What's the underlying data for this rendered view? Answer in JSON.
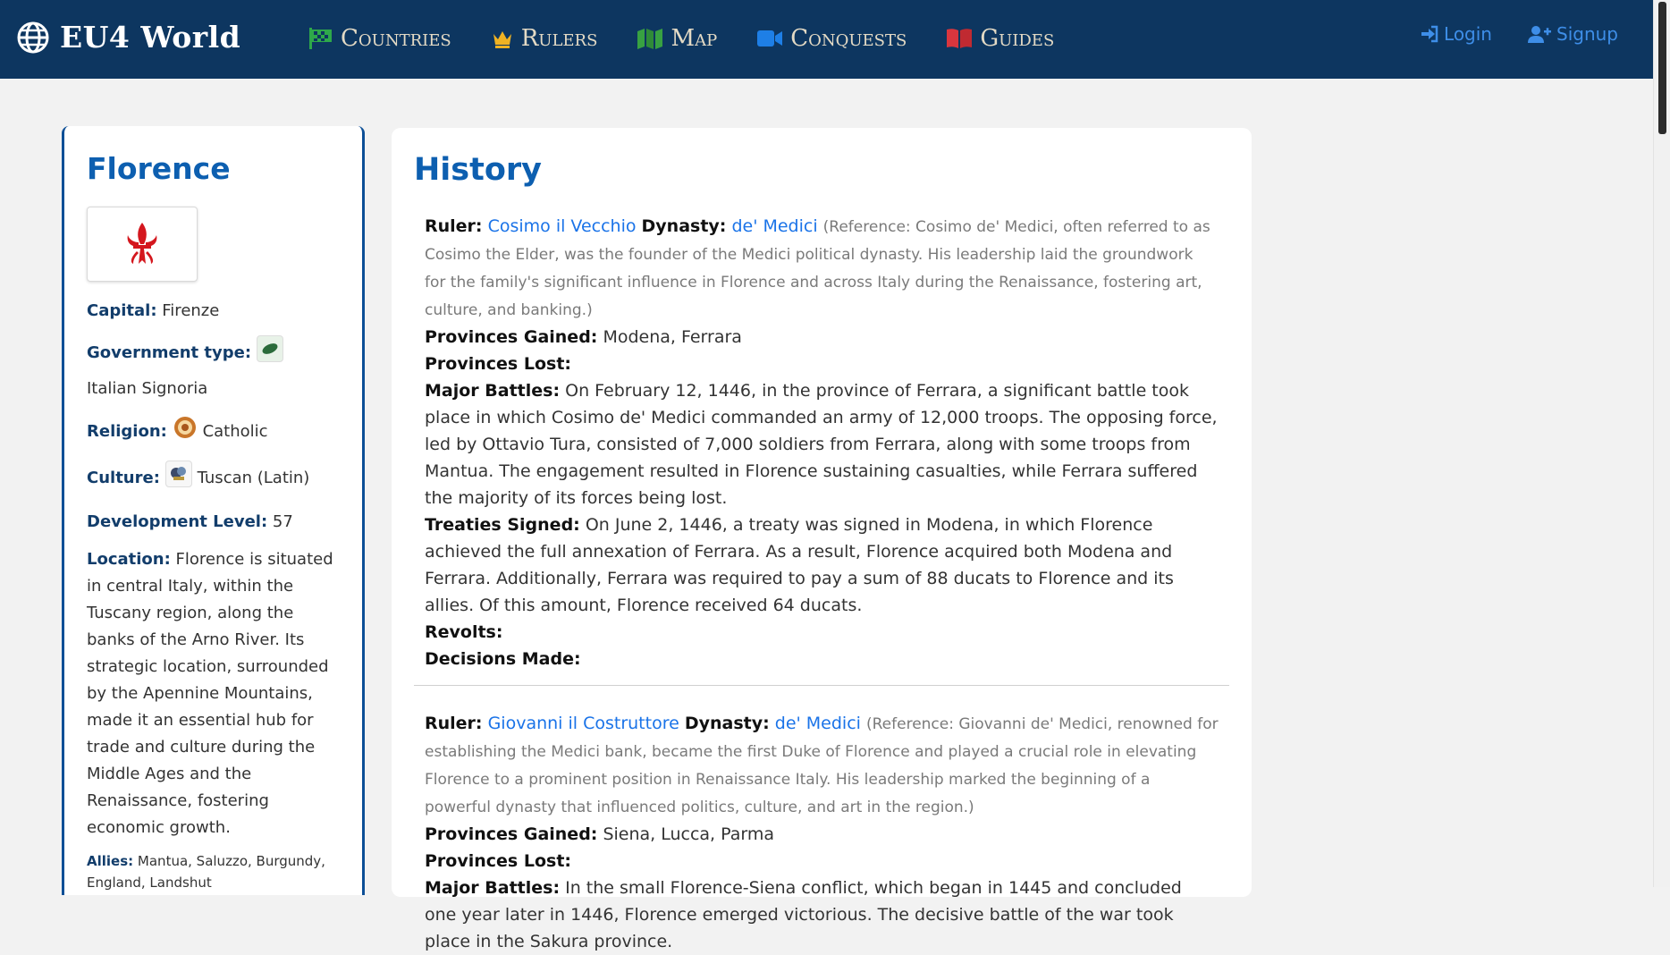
{
  "brand": {
    "name": "EU4 World",
    "icon": "globe-icon"
  },
  "nav": [
    {
      "label": "Countries",
      "icon": "checkered-flag-icon",
      "color": "#2ea84a"
    },
    {
      "label": "Rulers",
      "icon": "crown-icon",
      "color": "#f0b323"
    },
    {
      "label": "Map",
      "icon": "map-icon",
      "color": "#38a142"
    },
    {
      "label": "Conquests",
      "icon": "video-camera-icon",
      "color": "#1e7fe6"
    },
    {
      "label": "Guides",
      "icon": "book-icon",
      "color": "#d9363e"
    }
  ],
  "auth": {
    "login": "Login",
    "signup": "Signup"
  },
  "sidebar": {
    "name": "Florence",
    "capital_label": "Capital:",
    "capital": "Firenze",
    "government_label": "Government type:",
    "government": "Italian Signoria",
    "religion_label": "Religion:",
    "religion": "Catholic",
    "culture_label": "Culture:",
    "culture": "Tuscan (Latin)",
    "development_label": "Development Level:",
    "development": "57",
    "location_label": "Location:",
    "location": "Florence is situated in central Italy, within the Tuscany region, along the banks of the Arno River. Its strategic location, surrounded by the Apennine Mountains, made it an essential hub for trade and culture during the Middle Ages and the Renaissance, fostering economic growth.",
    "allies_label": "Allies:",
    "allies": "Mantua, Saluzzo, Burgundy, England, Landshut"
  },
  "main": {
    "title": "History",
    "labels": {
      "ruler": "Ruler:",
      "dynasty": "Dynasty:",
      "gained": "Provinces Gained:",
      "lost": "Provinces Lost:",
      "battles": "Major Battles:",
      "treaties": "Treaties Signed:",
      "revolts": "Revolts:",
      "decisions": "Decisions Made:"
    },
    "entries": [
      {
        "ruler": "Cosimo il Vecchio",
        "dynasty": "de' Medici",
        "reference": "(Reference: Cosimo de' Medici, often referred to as Cosimo the Elder, was the founder of the Medici political dynasty. His leadership laid the groundwork for the family's significant influence in Florence and across Italy during the Renaissance, fostering art, culture, and banking.)",
        "gained": "Modena, Ferrara",
        "lost": "",
        "battles": "On February 12, 1446, in the province of Ferrara, a significant battle took place in which Cosimo de' Medici commanded an army of 12,000 troops. The opposing force, led by Ottavio Tura, consisted of 7,000 soldiers from Ferrara, along with some troops from Mantua. The engagement resulted in Florence sustaining casualties, while Ferrara suffered the majority of its forces being lost.",
        "treaties": "On June 2, 1446, a treaty was signed in Modena, in which Florence achieved the full annexation of Ferrara. As a result, Florence acquired both Modena and Ferrara. Additionally, Ferrara was required to pay a sum of 88 ducats to Florence and its allies. Of this amount, Florence received 64 ducats.",
        "revolts": "",
        "decisions": ""
      },
      {
        "ruler": "Giovanni il Costruttore",
        "dynasty": "de' Medici",
        "reference": "(Reference: Giovanni de' Medici, renowned for establishing the Medici bank, became the first Duke of Florence and played a crucial role in elevating Florence to a prominent position in Renaissance Italy. His leadership marked the beginning of a powerful dynasty that influenced politics, culture, and art in the region.)",
        "gained": "Siena, Lucca, Parma",
        "lost": "",
        "battles": "In the small Florence-Siena conflict, which began in 1445 and concluded one year later in 1446, Florence emerged victorious. The decisive battle of the war took place in the Sakura province."
      }
    ]
  }
}
